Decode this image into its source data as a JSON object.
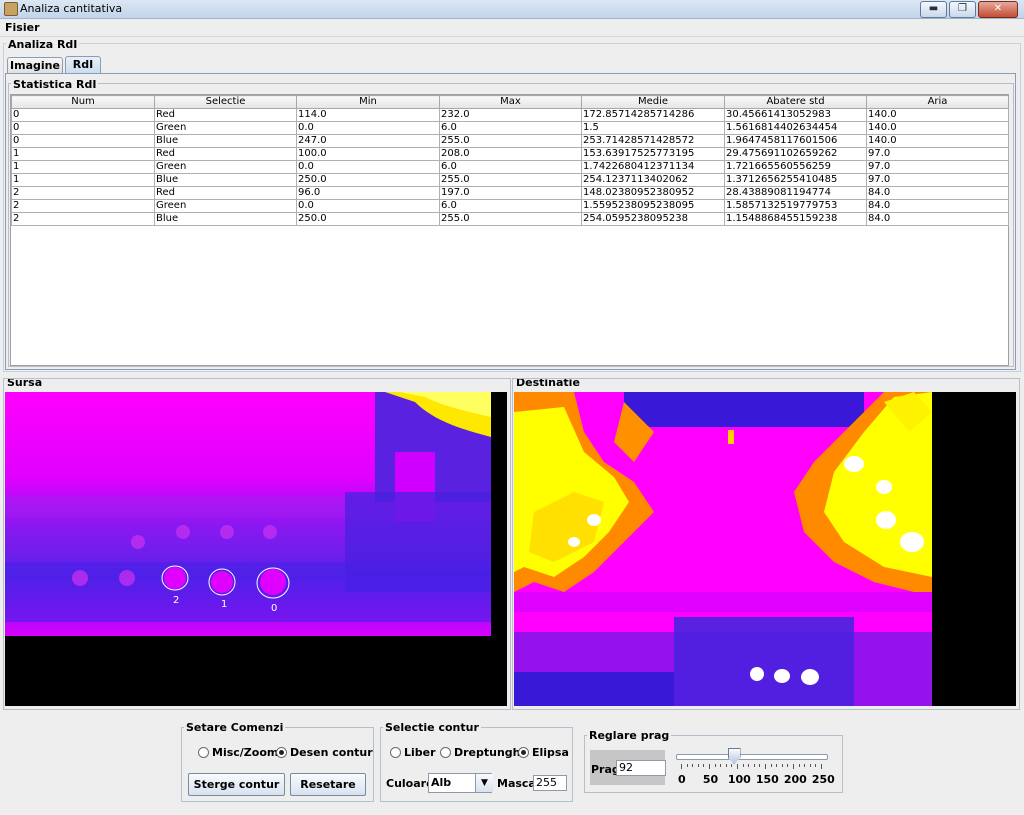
{
  "window": {
    "title": "Analiza cantitativa",
    "buttons": {
      "minimize": "▬",
      "maximize": "❐",
      "close": "✕"
    }
  },
  "menu": {
    "file": "Fisier"
  },
  "main_group": {
    "title": "Analiza RdI"
  },
  "tabs": [
    {
      "label": "Imagine",
      "active": false
    },
    {
      "label": "RdI",
      "active": true
    }
  ],
  "stats_panel": {
    "title": "Statistica RdI",
    "columns": [
      "Num",
      "Selectie",
      "Min",
      "Max",
      "Medie",
      "Abatere std",
      "Aria"
    ],
    "rows": [
      [
        "0",
        "Red",
        "114.0",
        "232.0",
        "172.85714285714286",
        "30.45661413052983",
        "140.0"
      ],
      [
        "0",
        "Green",
        "0.0",
        "6.0",
        "1.5",
        "1.5616814402634454",
        "140.0"
      ],
      [
        "0",
        "Blue",
        "247.0",
        "255.0",
        "253.71428571428572",
        "1.9647458117601506",
        "140.0"
      ],
      [
        "1",
        "Red",
        "100.0",
        "208.0",
        "153.63917525773195",
        "29.475691102659262",
        "97.0"
      ],
      [
        "1",
        "Green",
        "0.0",
        "6.0",
        "1.7422680412371134",
        "1.721665560556259",
        "97.0"
      ],
      [
        "1",
        "Blue",
        "250.0",
        "255.0",
        "254.1237113402062",
        "1.3712656255410485",
        "97.0"
      ],
      [
        "2",
        "Red",
        "96.0",
        "197.0",
        "148.02380952380952",
        "28.438890811947​74",
        "84.0"
      ],
      [
        "2",
        "Green",
        "0.0",
        "6.0",
        "1.5595238095238095",
        "1.5857132519779753",
        "84.0"
      ],
      [
        "2",
        "Blue",
        "250.0",
        "255.0",
        "254.0595238095238",
        "1.1548868455159238",
        "84.0"
      ]
    ]
  },
  "source_panel": {
    "title": "Sursa",
    "roi_labels": [
      "2",
      "1",
      "0"
    ]
  },
  "dest_panel": {
    "title": "Destinatie"
  },
  "commands": {
    "title": "Setare Comenzi",
    "radio_misc_zoom": "Misc/Zoom",
    "radio_desen_contur": "Desen contur",
    "selected": "Desen contur",
    "btn_sterge": "Sterge contur",
    "btn_resetare": "Resetare"
  },
  "contour": {
    "title": "Selectie contur",
    "radio_liber": "Liber",
    "radio_dreptunghi": "Dreptunghi",
    "radio_elipsa": "Elipsa",
    "selected": "Elipsa",
    "color_label": "Culoare",
    "color_value": "Alb",
    "mask_label": "Masca",
    "mask_value": "255"
  },
  "threshold": {
    "title": "Reglare prag",
    "label": "Prag",
    "value": "92",
    "slider_value": 92,
    "slider_min": 0,
    "slider_max": 250,
    "ticks": [
      "0",
      "50",
      "100",
      "150",
      "200",
      "250"
    ]
  },
  "colors": {
    "magenta": "#ff00ff",
    "blue": "#3a1cd8",
    "yellow": "#ffff00",
    "orange": "#ff8a00"
  }
}
